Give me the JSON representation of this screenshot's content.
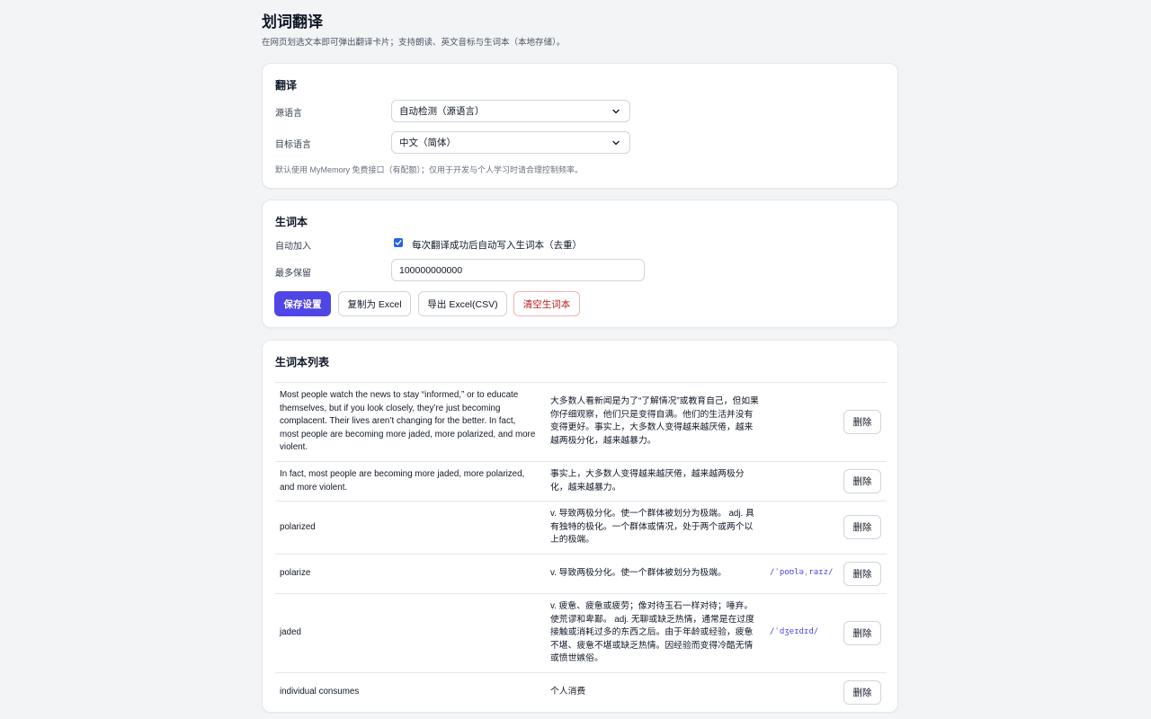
{
  "page": {
    "title": "划词翻译",
    "subtitle": "在网页划选文本即可弹出翻译卡片；支持朗读、英文音标与生词本（本地存储）。"
  },
  "translate": {
    "title": "翻译",
    "source_label": "源语言",
    "source_value": "自动检测（源语言）",
    "target_label": "目标语言",
    "target_value": "中文（简体）",
    "hint": "默认使用 MyMemory 免费接口（有配额）；仅用于开发与个人学习时请合理控制频率。"
  },
  "vocab": {
    "title": "生词本",
    "auto_label": "自动加入",
    "auto_checked": true,
    "auto_text": "每次翻译成功后自动写入生词本（去重）",
    "max_label": "最多保留",
    "max_value": "100000000000",
    "buttons": {
      "save": "保存设置",
      "copy_excel": "复制为 Excel",
      "export_csv": "导出 Excel(CSV)",
      "clear": "清空生词本"
    }
  },
  "list": {
    "title": "生词本列表",
    "delete_label": "删除",
    "rows": [
      {
        "source": "Most people watch the news to stay “informed,” or to educate themselves, but if you look closely, they’re just becoming complacent. Their lives aren’t changing for the better. In fact, most people are becoming more jaded, more polarized, and more violent.",
        "translation": "大多数人看新闻是为了“了解情况”或教育自己，但如果你仔细观察，他们只是变得自满。他们的生活并没有变得更好。事实上，大多数人变得越来越厌倦，越来越两极分化，越来越暴力。",
        "phonetic": ""
      },
      {
        "source": "In fact, most people are becoming more jaded, more polarized, and more violent.",
        "translation": "事实上，大多数人变得越来越厌倦，越来越两极分化，越来越暴力。",
        "phonetic": ""
      },
      {
        "source": "polarized",
        "translation": "v. 导致两极分化。使一个群体被划分为极端。 adj. 具有独特的极化。一个群体或情况，处于两个或两个以上的极端。",
        "phonetic": ""
      },
      {
        "source": "polarize",
        "translation": "v. 导致两极分化。使一个群体被划分为极端。",
        "phonetic": "/ˈpoʊləˌraɪz/"
      },
      {
        "source": "jaded",
        "translation": "v. 疲惫、疲惫或疲劳；像对待玉石一样对待；唾弃。使荒谬和卑鄙。 adj. 无聊或缺乏热情，通常是在过度接触或消耗过多的东西之后。由于年龄或经验，疲惫不堪、疲惫不堪或缺乏热情。因经验而变得冷酷无情或愤世嫉俗。",
        "phonetic": "/ˈdʒeɪdɪd/"
      },
      {
        "source": "individual consumes",
        "translation": "个人消费",
        "phonetic": ""
      }
    ]
  }
}
